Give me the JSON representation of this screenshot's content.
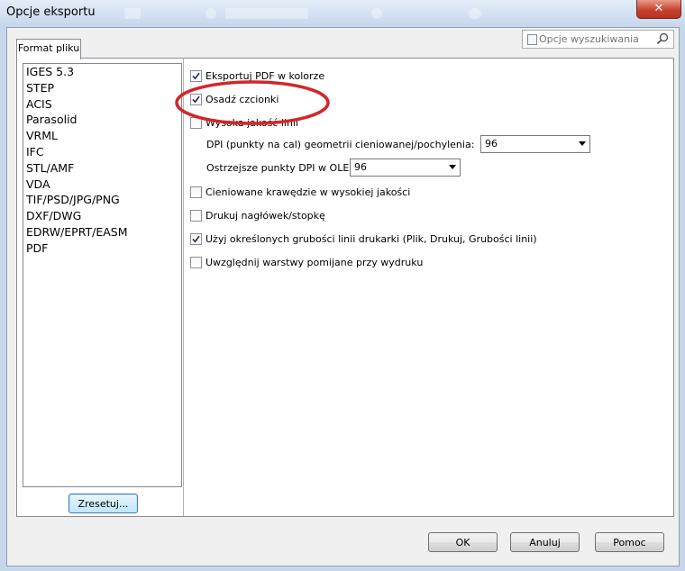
{
  "window": {
    "title": "Opcje eksportu",
    "close_label": "✕"
  },
  "tabs": [
    {
      "label": "Format pliku"
    }
  ],
  "search": {
    "placeholder": "Opcje wyszukiwania"
  },
  "formats": [
    {
      "label": "IGES 5.3"
    },
    {
      "label": "STEP"
    },
    {
      "label": "ACIS"
    },
    {
      "label": "Parasolid"
    },
    {
      "label": "VRML"
    },
    {
      "label": "IFC"
    },
    {
      "label": "STL/AMF"
    },
    {
      "label": "VDA"
    },
    {
      "label": "TIF/PSD/JPG/PNG"
    },
    {
      "label": "DXF/DWG"
    },
    {
      "label": "EDRW/EPRT/EASM"
    },
    {
      "label": "PDF"
    }
  ],
  "selected_format": "PDF",
  "reset_label": "Zresetuj...",
  "options": {
    "export_color": {
      "label": "Eksportuj PDF w kolorze",
      "checked": true
    },
    "embed_fonts": {
      "label": "Osadź czcionki",
      "checked": true
    },
    "high_quality_lines": {
      "label": "Wysoka jakość linii",
      "checked": false
    },
    "dpi_label": "DPI (punkty na cal) geometrii cieniowanej/pochylenia:",
    "dpi_value": "96",
    "ole_dpi_label": "Ostrzejsze punkty DPI w OLE:",
    "ole_dpi_value": "96",
    "hq_shaded_edges": {
      "label": "Cieniowane krawędzie w wysokiej jakości",
      "checked": false
    },
    "print_header_footer": {
      "label": "Drukuj nagłówek/stopkę",
      "checked": false
    },
    "use_line_weights": {
      "label": "Użyj określonych grubości linii drukarki (Plik, Drukuj, Grubości linii)",
      "checked": true
    },
    "include_skipped_layers": {
      "label": "Uwzględnij warstwy pomijane przy wydruku",
      "checked": false
    }
  },
  "buttons": {
    "ok": "OK",
    "cancel": "Anuluj",
    "help": "Pomoc"
  },
  "annotation": {
    "color": "#d3262a"
  }
}
